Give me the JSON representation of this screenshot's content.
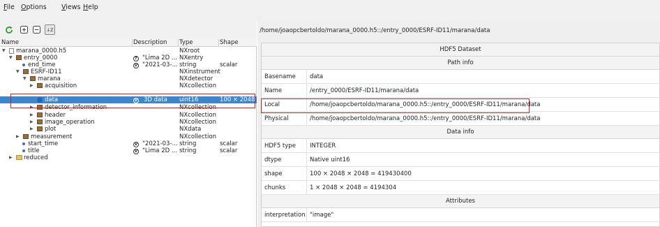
{
  "menu": {
    "file": {
      "underline": "F",
      "rest": "ile"
    },
    "options": {
      "underline": "O",
      "rest": "ptions"
    },
    "views": {
      "underline": "V",
      "rest": "iews"
    },
    "help": {
      "underline": "H",
      "rest": "elp"
    }
  },
  "toolbar": {
    "icons": [
      "refresh-icon",
      "expand-all-icon",
      "collapse-all-icon",
      "sort-icon"
    ],
    "sort_glyph": "↓Z"
  },
  "tree": {
    "columns": {
      "name": "Name",
      "description": "Description",
      "type": "Type",
      "shape": "Shape"
    },
    "rows": [
      {
        "name": "marana_0000.h5",
        "description": "",
        "type": "NXroot",
        "shape": "",
        "badge": ""
      },
      {
        "name": "entry_0000",
        "description": "\"Lima 2D ...",
        "type": "NXentry",
        "shape": "",
        "badge": "T"
      },
      {
        "name": "end_time",
        "description": "\"2021-03-...",
        "type": "string",
        "shape": "scalar",
        "badge": "V"
      },
      {
        "name": "ESRF-ID11",
        "description": "",
        "type": "NXinstrument",
        "shape": "",
        "badge": ""
      },
      {
        "name": "marana",
        "description": "",
        "type": "NXdetector",
        "shape": "",
        "badge": ""
      },
      {
        "name": "acquisition",
        "description": "",
        "type": "NXcollection",
        "shape": "",
        "badge": ""
      },
      {
        "name": "data",
        "description": "3D data",
        "type": "uint16",
        "shape": "100 × 2048",
        "badge": "V"
      },
      {
        "name": "detector_information",
        "description": "",
        "type": "NXcollection",
        "shape": "",
        "badge": ""
      },
      {
        "name": "header",
        "description": "",
        "type": "NXcollection",
        "shape": "",
        "badge": ""
      },
      {
        "name": "image_operation",
        "description": "",
        "type": "NXcollection",
        "shape": "",
        "badge": ""
      },
      {
        "name": "plot",
        "description": "",
        "type": "NXdata",
        "shape": "",
        "badge": ""
      },
      {
        "name": "measurement",
        "description": "",
        "type": "NXcollection",
        "shape": "",
        "badge": ""
      },
      {
        "name": "start_time",
        "description": "\"2021-03-...",
        "type": "string",
        "shape": "scalar",
        "badge": "V"
      },
      {
        "name": "title",
        "description": "\"Lima 2D ...",
        "type": "string",
        "shape": "scalar",
        "badge": "V"
      },
      {
        "name": "reduced",
        "description": "",
        "type": "",
        "shape": "",
        "badge": ""
      }
    ]
  },
  "panel": {
    "path": "/home/joaopcbertoldo/marana_0000.h5::/entry_0000/ESRF-ID11/marana/data",
    "title": "HDF5 Dataset",
    "path_info": "Path info",
    "basename": {
      "key": "Basename",
      "value": "data"
    },
    "name": {
      "key": "Name",
      "value": "/entry_0000/ESRF-ID11/marana/data"
    },
    "local": {
      "key": "Local",
      "value": "/home/joaopcbertoldo/marana_0000.h5::/entry_0000/ESRF-ID11/marana/data"
    },
    "physical": {
      "key": "Physical",
      "value": "/home/joaopcbertoldo/marana_0000.h5::/entry_0000/ESRF-ID11/marana/data"
    },
    "data_info": "Data info",
    "hdf5_type": {
      "key": "HDF5 type",
      "value": "INTEGER"
    },
    "dtype": {
      "key": "dtype",
      "value": "Native uint16"
    },
    "shape": {
      "key": "shape",
      "value": "100 × 2048 × 2048 = 419430400"
    },
    "chunks": {
      "key": "chunks",
      "value": "1 × 2048 × 2048 = 4194304"
    },
    "attributes": "Attributes",
    "interpretation": {
      "key": "interpretation",
      "value": "\"image\""
    }
  },
  "colors": {
    "selection": "#3b86cf",
    "highlight_box": "#d11f1f"
  }
}
